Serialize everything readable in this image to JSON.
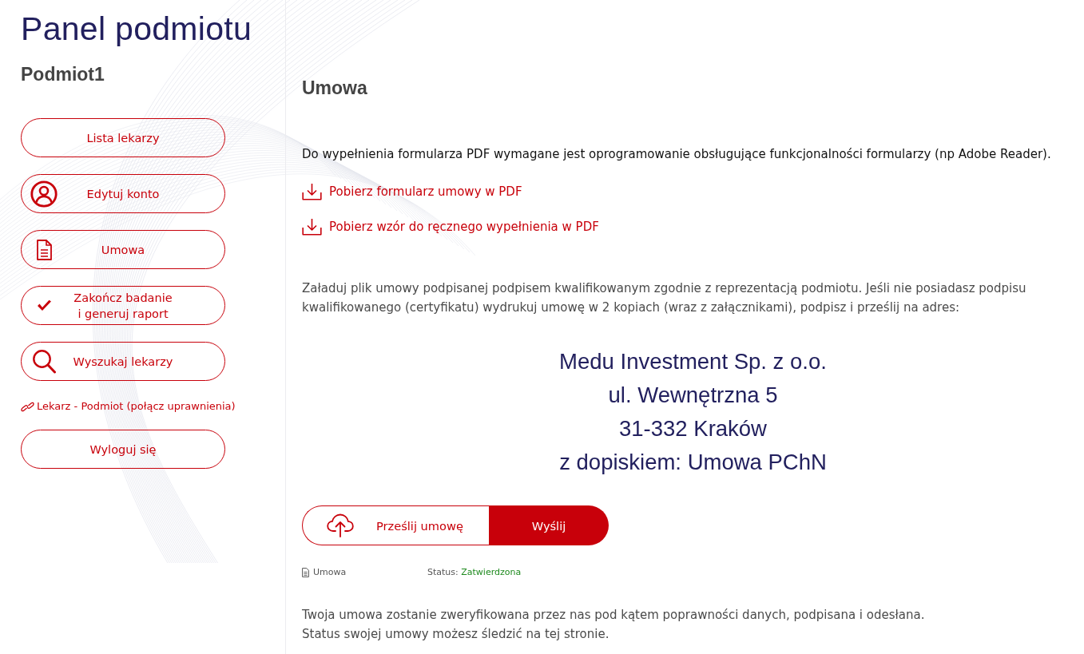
{
  "sidebar": {
    "title": "Panel podmiotu",
    "subtitle": "Podmiot1",
    "items": [
      {
        "kind": "button",
        "label": "Lista lekarzy"
      },
      {
        "kind": "button",
        "label": "Edytuj konto"
      },
      {
        "kind": "button",
        "label": "Umowa"
      },
      {
        "kind": "button",
        "label": "Zakończ badanie\ni generuj raport"
      },
      {
        "kind": "button",
        "label": "Wyszukaj lekarzy"
      },
      {
        "kind": "link",
        "label": "Lekarz - Podmiot (połącz uprawnienia)"
      },
      {
        "kind": "button",
        "label": "Wyloguj się"
      }
    ]
  },
  "main": {
    "heading": "Umowa",
    "note": "Do wypełnienia formularza PDF wymagane jest oprogramowanie obsługujące funkcjonalności formularzy (np Adobe Reader).",
    "downloads": [
      {
        "label": "Pobierz formularz umowy w PDF"
      },
      {
        "label": "Pobierz wzór do ręcznego wypełnienia w PDF"
      }
    ],
    "instructions": "Załaduj plik umowy podpisanej podpisem kwalifikowanym zgodnie z reprezentacją podmiotu. Jeśli nie posiadasz podpisu kwalifikowanego (certyfikatu) wydrukuj umowę w 2 kopiach (wraz z załącznikami), podpisz i prześlij na adres:",
    "address": [
      "Medu Investment Sp. z o.o.",
      "ul. Wewnętrzna 5",
      "31-332 Kraków",
      "z dopiskiem: Umowa PChN"
    ],
    "upload": {
      "file_button": "Prześlij umowę",
      "submit_button": "Wyślij"
    },
    "file": {
      "name": "Umowa",
      "status_label": "Status:",
      "status_value": "Zatwierdzona"
    },
    "footer": [
      "Twoja umowa zostanie zweryfikowana przez nas pod kątem poprawności danych, podpisana i odesłana.",
      "Status swojej umowy możesz śledzić na tej stronie."
    ]
  }
}
